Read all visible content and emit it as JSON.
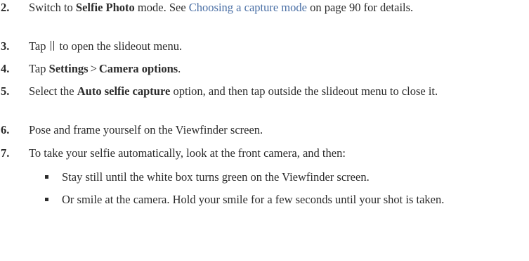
{
  "steps": [
    {
      "num": "2.",
      "pre": "Switch to ",
      "bold": "Selfie Photo",
      "mid": " mode. See ",
      "link": "Choosing a capture mode",
      "post": " on page 90 for details."
    },
    {
      "num": "3.",
      "pre": "Tap",
      "icon": "slideout-menu-icon",
      "post": "to open the slideout menu."
    },
    {
      "num": "4.",
      "pre": "Tap ",
      "bold1": "Settings",
      "separator": ">",
      "bold2": "Camera options",
      "post": "."
    },
    {
      "num": "5.",
      "pre": "Select the ",
      "bold": "Auto selfie capture",
      "post": " option, and then tap outside the slideout menu to close it."
    },
    {
      "num": "6.",
      "text": "Pose and frame yourself on the Viewfinder screen."
    },
    {
      "num": "7.",
      "text": "To take your selfie automatically, look at the front camera, and then:"
    }
  ],
  "bullets": [
    "Stay still until the white box turns green on the Viewfinder screen.",
    "Or smile at the camera. Hold your smile for a few seconds until your shot is taken."
  ]
}
